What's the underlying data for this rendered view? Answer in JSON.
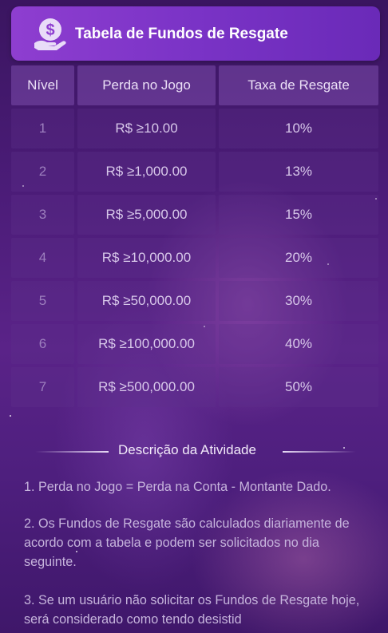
{
  "header": {
    "title": "Tabela de Fundos de Resgate",
    "icon": "money-hand-icon"
  },
  "table": {
    "columns": [
      "Nível",
      "Perda no Jogo",
      "Taxa de Resgate"
    ],
    "rows": [
      [
        "1",
        "R$ ≥10.00",
        "10%"
      ],
      [
        "2",
        "R$ ≥1,000.00",
        "13%"
      ],
      [
        "3",
        "R$ ≥5,000.00",
        "15%"
      ],
      [
        "4",
        "R$ ≥10,000.00",
        "20%"
      ],
      [
        "5",
        "R$ ≥50,000.00",
        "30%"
      ],
      [
        "6",
        "R$ ≥100,000.00",
        "40%"
      ],
      [
        "7",
        "R$ ≥500,000.00",
        "50%"
      ]
    ]
  },
  "description": {
    "title": "Descrição da Atividade",
    "items": [
      "1. Perda no Jogo = Perda na Conta - Montante Dado.",
      "2. Os Fundos de Resgate são calculados diariamente de acordo com a tabela e podem ser solicitados no dia seguinte.",
      "3. Se um usuário não solicitar os Fundos de Resgate hoje, será considerado como tendo desistid"
    ]
  },
  "colors": {
    "header_gradient_start": "#8e3ed0",
    "header_gradient_end": "#6a2ab8",
    "background": "#4b1c78"
  }
}
